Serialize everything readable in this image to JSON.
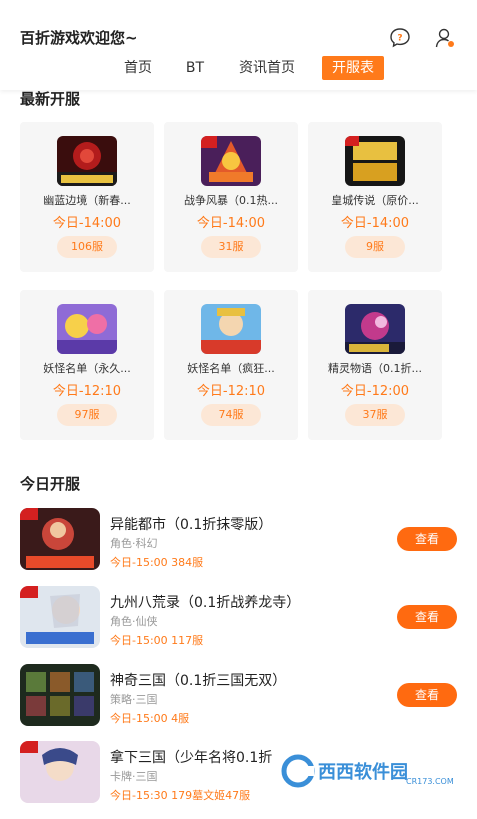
{
  "header": {
    "title": "百折游戏欢迎您~",
    "message_icon": "message-question-icon",
    "user_icon": "user-settings-icon"
  },
  "tabs": [
    {
      "label": "首页",
      "active": false
    },
    {
      "label": "BT",
      "active": false
    },
    {
      "label": "资讯首页",
      "active": false
    },
    {
      "label": "开服表",
      "active": true
    }
  ],
  "newest": {
    "title": "最新开服",
    "cards": [
      {
        "name": "幽蓝边境（新春...",
        "time": "今日-14:00",
        "servers": "106服"
      },
      {
        "name": "战争风暴（0.1热...",
        "time": "今日-14:00",
        "servers": "31服"
      },
      {
        "name": "皇城传说（原价...",
        "time": "今日-14:00",
        "servers": "9服"
      },
      {
        "name": "妖怪名单（永久...",
        "time": "今日-12:10",
        "servers": "97服"
      },
      {
        "name": "妖怪名单（疯狂...",
        "time": "今日-12:10",
        "servers": "74服"
      },
      {
        "name": "精灵物语（0.1折...",
        "time": "今日-12:00",
        "servers": "37服"
      }
    ]
  },
  "today": {
    "title": "今日开服",
    "button_label": "查看",
    "items": [
      {
        "name": "异能都市（0.1折抹零版）",
        "genre": "角色·科幻",
        "info": "今日-15:00 384服"
      },
      {
        "name": "九州八荒录（0.1折战养龙寺）",
        "genre": "角色·仙侠",
        "info": "今日-15:00 117服"
      },
      {
        "name": "神奇三国（0.1折三国无双）",
        "genre": "策略·三国",
        "info": "今日-15:00 4服"
      },
      {
        "name": "拿下三国（少年名将0.1折",
        "genre": "卡牌·三国",
        "info": "今日-15:30 179墓文姬47服"
      }
    ]
  },
  "watermark": {
    "brand": "西西软件园",
    "url": "CR173.COM"
  },
  "colors": {
    "accent": "#ff7a1a",
    "button": "#ff6a10",
    "pill_bg": "#fce7d6",
    "card_bg": "#f6f6f6"
  }
}
